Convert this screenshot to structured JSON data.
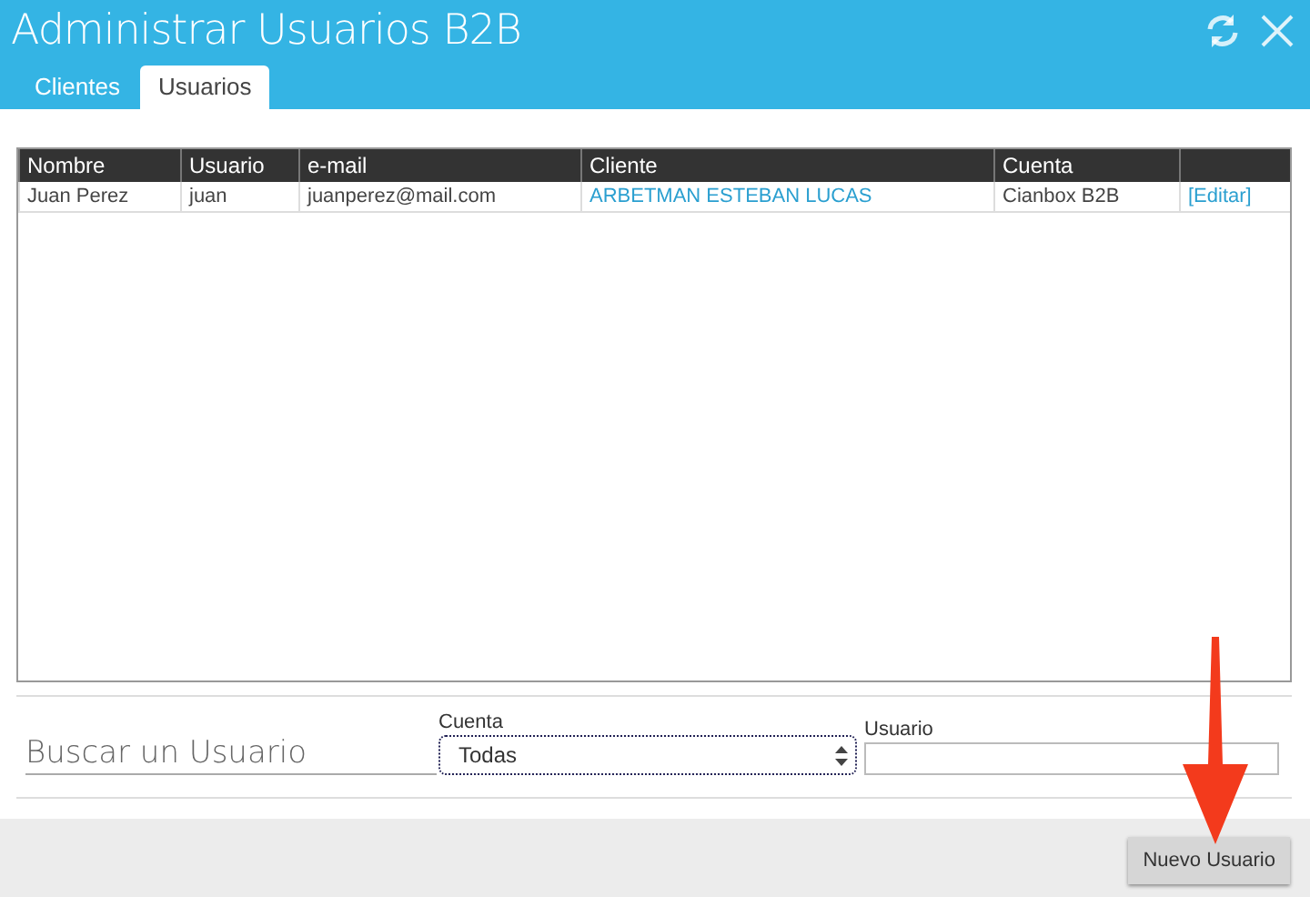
{
  "window": {
    "title": "Administrar Usuarios B2B"
  },
  "tabs": [
    {
      "label": "Clientes",
      "selected": false
    },
    {
      "label": "Usuarios",
      "selected": true
    }
  ],
  "table": {
    "columns": [
      "Nombre",
      "Usuario",
      "e-mail",
      "Cliente",
      "Cuenta",
      ""
    ],
    "rows": [
      {
        "cells": [
          "Juan Perez",
          "juan",
          "juanperez@mail.com",
          "ARBETMAN ESTEBAN LUCAS",
          "Cianbox B2B",
          "[Editar]"
        ]
      }
    ]
  },
  "search": {
    "title": "Buscar un Usuario",
    "cuenta": {
      "label": "Cuenta",
      "value": "Todas"
    },
    "usuario": {
      "label": "Usuario"
    }
  },
  "buttons": [
    "Nuevo Usuario"
  ]
}
